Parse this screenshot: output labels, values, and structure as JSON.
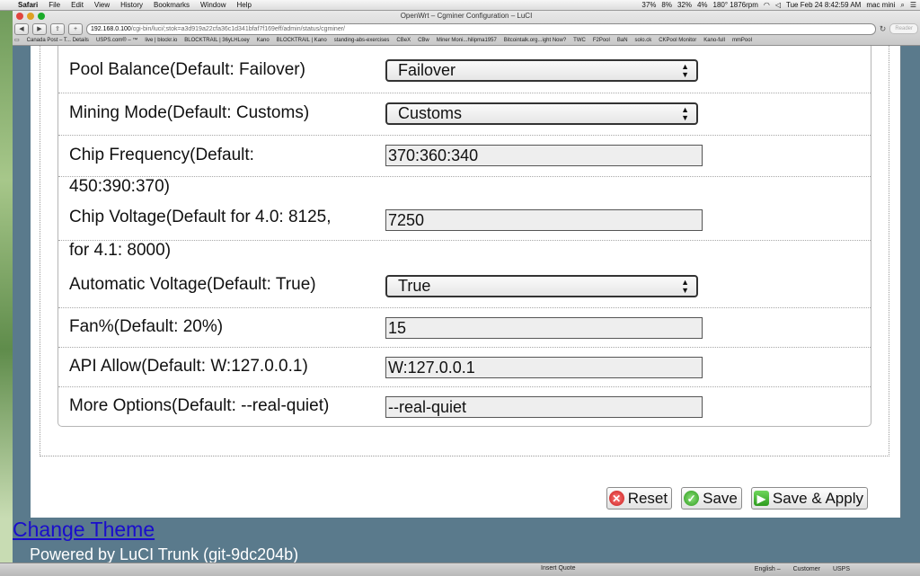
{
  "menubar": {
    "app": "Safari",
    "items": [
      "File",
      "Edit",
      "View",
      "History",
      "Bookmarks",
      "Window",
      "Help"
    ],
    "status": [
      "37%",
      "8%",
      "32%",
      "4%",
      "180° 1876rpm"
    ],
    "clock": "Tue Feb 24  8:42:59 AM",
    "user": "mac mini"
  },
  "browser": {
    "window_title": "OpenWrt – Cgminer Configuration – LuCI",
    "url_host": "192.168.0.100",
    "url_path": "/cgi-bin/luci/;stok=a3d919a22cfa36c1d341bfaf7f169eff/admin/status/cgminer/",
    "reader": "Reader",
    "bookmarks": [
      "Canada Post – T... Details",
      "USPS.com® – ™",
      "live | blockr.io",
      "BLOCKTRAIL | 36yLHLoey",
      "Kano",
      "BLOCKTRAIL | Kano",
      "standing-abs-exercises",
      "CBeX",
      "CBw",
      "Miner Moni...hilipma1957",
      "Bitcointalk.org...ight Now?",
      "TWC",
      "F2Pool",
      "BaN",
      "solo.ck",
      "CKPool Monitor",
      "Kano-full",
      "mmPool"
    ]
  },
  "form": {
    "pool_balance": {
      "label": "Pool Balance(Default: Failover)",
      "value": "Failover"
    },
    "mining_mode": {
      "label": "Mining Mode(Default: Customs)",
      "value": "Customs"
    },
    "chip_frequency": {
      "label": "Chip Frequency(Default: 450:390:370)",
      "value": "370:360:340"
    },
    "chip_voltage": {
      "label": "Chip Voltage(Default for 4.0: 8125, for 4.1: 8000)",
      "value": "7250"
    },
    "auto_voltage": {
      "label": "Automatic Voltage(Default: True)",
      "value": "True"
    },
    "fan": {
      "label": "Fan%(Default: 20%)",
      "value": "15"
    },
    "api_allow": {
      "label": "API Allow(Default: W:127.0.0.1)",
      "value": "W:127.0.0.1"
    },
    "more_options": {
      "label": "More Options(Default: --real-quiet)",
      "value": "--real-quiet"
    }
  },
  "buttons": {
    "reset": "Reset",
    "save": "Save",
    "save_apply": "Save & Apply"
  },
  "footer": {
    "change_theme": "Change Theme",
    "powered_by": "Powered by LuCI Trunk (git-9dc204b)"
  },
  "statusbar": {
    "insert_quote": "Insert Quote",
    "english": "English –",
    "customer": "Customer",
    "usps": "USPS"
  }
}
